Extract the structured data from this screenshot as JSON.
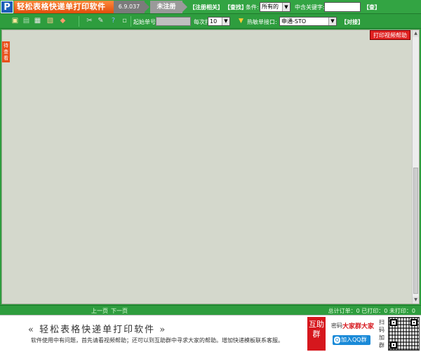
{
  "titlebar": {
    "logo": "P",
    "app_name": "轻松表格快递单打印软件",
    "version": "6.9.037",
    "reg_status": "未注册",
    "register_link": "【注册相关】",
    "search_link": "【查找】",
    "condition_label": "条件:",
    "condition_value": "所有的",
    "keyword_label": "中含关键字:",
    "keyword_value": "",
    "search_button": "【查】"
  },
  "toolbar": {
    "start_no_label": "起始单号",
    "start_no_value": "",
    "per_print_label": "每次打",
    "per_print_value": "10",
    "interface_label": "热敏单接口:",
    "interface_value": "申通-STO",
    "connect_link": "【对接】",
    "icons": [
      "open-folder-icon",
      "export-icon",
      "print-icon",
      "print-preview-icon",
      "erase-icon",
      "settings-icon",
      "tools-icon",
      "help-icon",
      "info-icon"
    ]
  },
  "workspace": {
    "side_tab_label": "待查看",
    "help_button": "打印视频帮助"
  },
  "statusbar": {
    "prev_page": "上一页",
    "next_page": "下一页",
    "stats": "总计订单：0 已打印：0 未打印：0"
  },
  "footer": {
    "slogan": "« 轻松表格快递单打印软件 »",
    "help_text": "软件使用中有问题，首先请看视频帮助；还可以到互助群中寻求大家的帮助。增加快递模板联系客服。",
    "group_badge": "互助群",
    "pass_label": "密码",
    "pass_value": "大家群大家",
    "qq_button": "加入QQ群",
    "scan_text": "扫码加群"
  },
  "colors": {
    "chrome_green": "#2e9d3e",
    "workspace_bg": "#d4d8cc",
    "accent_orange": "#e8501a",
    "badge_red": "#d6171d"
  }
}
